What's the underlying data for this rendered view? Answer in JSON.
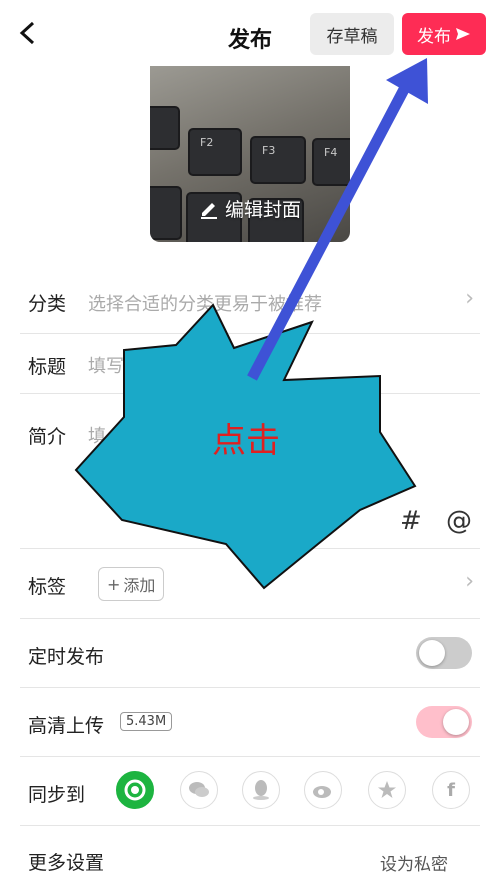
{
  "topbar": {
    "title": "发布",
    "draft_label": "存草稿",
    "publish_label": "发布"
  },
  "cover": {
    "edit_label": "编辑封面",
    "keys": [
      "F2",
      "F3",
      "F4"
    ]
  },
  "form": {
    "category_label": "分类",
    "category_placeholder": "选择合适的分类更易于被推荐",
    "title_label": "标题",
    "title_placeholder": "填写",
    "intro_label": "简介",
    "intro_placeholder": "填",
    "hashtag_symbol": "#",
    "mention_symbol": "@",
    "tags_label": "标签",
    "tags_add_label": "添加",
    "schedule_label": "定时发布",
    "hd_label": "高清上传",
    "hd_size": "5.43M",
    "sync_label": "同步到",
    "more_label": "更多设置"
  },
  "toggles": {
    "schedule_on": false,
    "hd_on": true,
    "colors": {
      "off": "#cccccc",
      "on": "#ffbfcb",
      "accent": "#fe2c55"
    }
  },
  "annotation": {
    "text": "点击",
    "fill": "#1aa9c8",
    "text_color": "#e02020",
    "arrow_color": "#3e52d6"
  },
  "share_targets": [
    "check-circle-icon",
    "wechat-icon",
    "qq-icon",
    "weibo-icon",
    "star-icon",
    "facebook-icon"
  ],
  "watermark": "设为私密"
}
